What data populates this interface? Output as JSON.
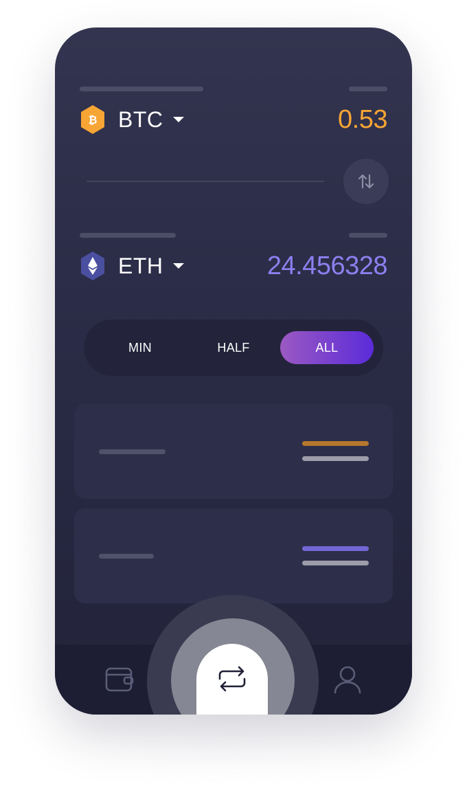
{
  "from": {
    "symbol": "BTC",
    "amount": "0.53",
    "amount_color": "#f7a534",
    "icon": "bitcoin-icon"
  },
  "to": {
    "symbol": "ETH",
    "amount": "24.456328",
    "amount_color": "#8e7ff0",
    "icon": "ethereum-icon"
  },
  "swap_icon": "swap-vertical-icon",
  "amount_options": [
    {
      "label": "MIN",
      "active": false
    },
    {
      "label": "HALF",
      "active": false
    },
    {
      "label": "ALL",
      "active": true
    }
  ],
  "nav": {
    "items": [
      {
        "icon": "wallet-icon"
      },
      {
        "icon": "exchange-icon",
        "active": true
      },
      {
        "icon": "user-icon"
      }
    ]
  },
  "colors": {
    "background": "#2b2c47",
    "accent_gradient": [
      "#9b59c2",
      "#5b2bd9"
    ],
    "btc": "#f7a534",
    "eth": "#8e7ff0"
  }
}
